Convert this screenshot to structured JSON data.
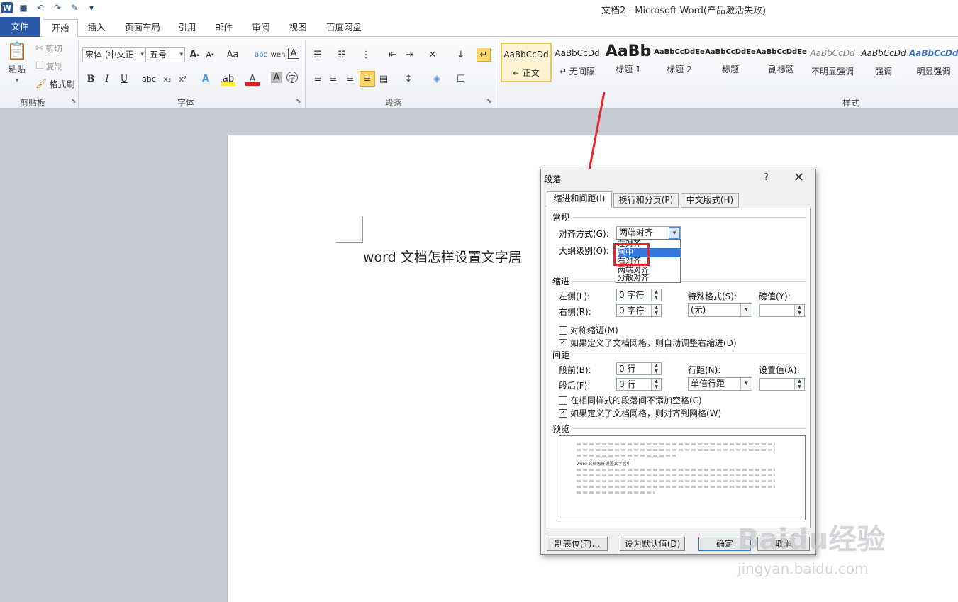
{
  "window": {
    "title": "文档2 - Microsoft Word(产品激活失败)"
  },
  "tabs": [
    "文件",
    "开始",
    "插入",
    "页面布局",
    "引用",
    "邮件",
    "审阅",
    "视图",
    "百度网盘"
  ],
  "ribbon": {
    "clipboard": {
      "paste": "粘贴",
      "cut": "剪切",
      "copy": "复制",
      "format_painter": "格式刷",
      "label": "剪贴板"
    },
    "font": {
      "font_name": "宋体 (中文正:",
      "font_size": "五号",
      "label": "字体"
    },
    "paragraph": {
      "label": "段落"
    },
    "styles": {
      "label": "样式",
      "items": [
        {
          "sample": "AaBbCcDd",
          "name": "↵ 正文"
        },
        {
          "sample": "AaBbCcDd",
          "name": "↵ 无间隔"
        },
        {
          "sample": "AaBb",
          "name": "标题 1"
        },
        {
          "sample": "AaBbCcDdEe",
          "name": "标题 2"
        },
        {
          "sample": "AaBbCcDdEe",
          "name": "标题"
        },
        {
          "sample": "AaBbCcDdEe",
          "name": "副标题"
        },
        {
          "sample": "AaBbCcDd",
          "name": "不明显强调"
        },
        {
          "sample": "AaBbCcDd",
          "name": "强调"
        },
        {
          "sample": "AaBbCcDd",
          "name": "明显强调"
        }
      ]
    }
  },
  "document": {
    "text": "word 文档怎样设置文字居"
  },
  "dialog": {
    "title": "段落",
    "help": "?",
    "tabs": [
      "缩进和间距(I)",
      "换行和分页(P)",
      "中文版式(H)"
    ],
    "general": {
      "section": "常规",
      "alignment_label": "对齐方式(G):",
      "alignment_value": "两端对齐",
      "outline_label": "大纲级别(O):",
      "alignment_options": [
        "左对齐",
        "居中",
        "右对齐",
        "两端对齐",
        "分散对齐"
      ]
    },
    "indent": {
      "section": "缩进",
      "left_label": "左侧(L):",
      "left_value": "0 字符",
      "right_label": "右侧(R):",
      "right_value": "0 字符",
      "special_label": "特殊格式(S):",
      "special_value": "(无)",
      "by_label": "磅值(Y):",
      "mirror": "对称缩进(M)",
      "auto_adjust": "如果定义了文档网格，则自动调整右缩进(D)"
    },
    "spacing": {
      "section": "间距",
      "before_label": "段前(B):",
      "before_value": "0 行",
      "after_label": "段后(F):",
      "after_value": "0 行",
      "line_label": "行距(N):",
      "line_value": "单倍行距",
      "at_label": "设置值(A):",
      "no_space": "在相同样式的段落间不添加空格(C)",
      "snap_grid": "如果定义了文档网格，则对齐到网格(W)"
    },
    "preview": {
      "section": "预览",
      "sample_text": "word 文档怎样设置文字居中"
    },
    "buttons": {
      "tabs": "制表位(T)...",
      "set_default": "设为默认值(D)",
      "ok": "确定",
      "cancel": "取消"
    }
  },
  "watermark": {
    "brand": "Baidu经验",
    "url": "jingyan.baidu.com"
  }
}
